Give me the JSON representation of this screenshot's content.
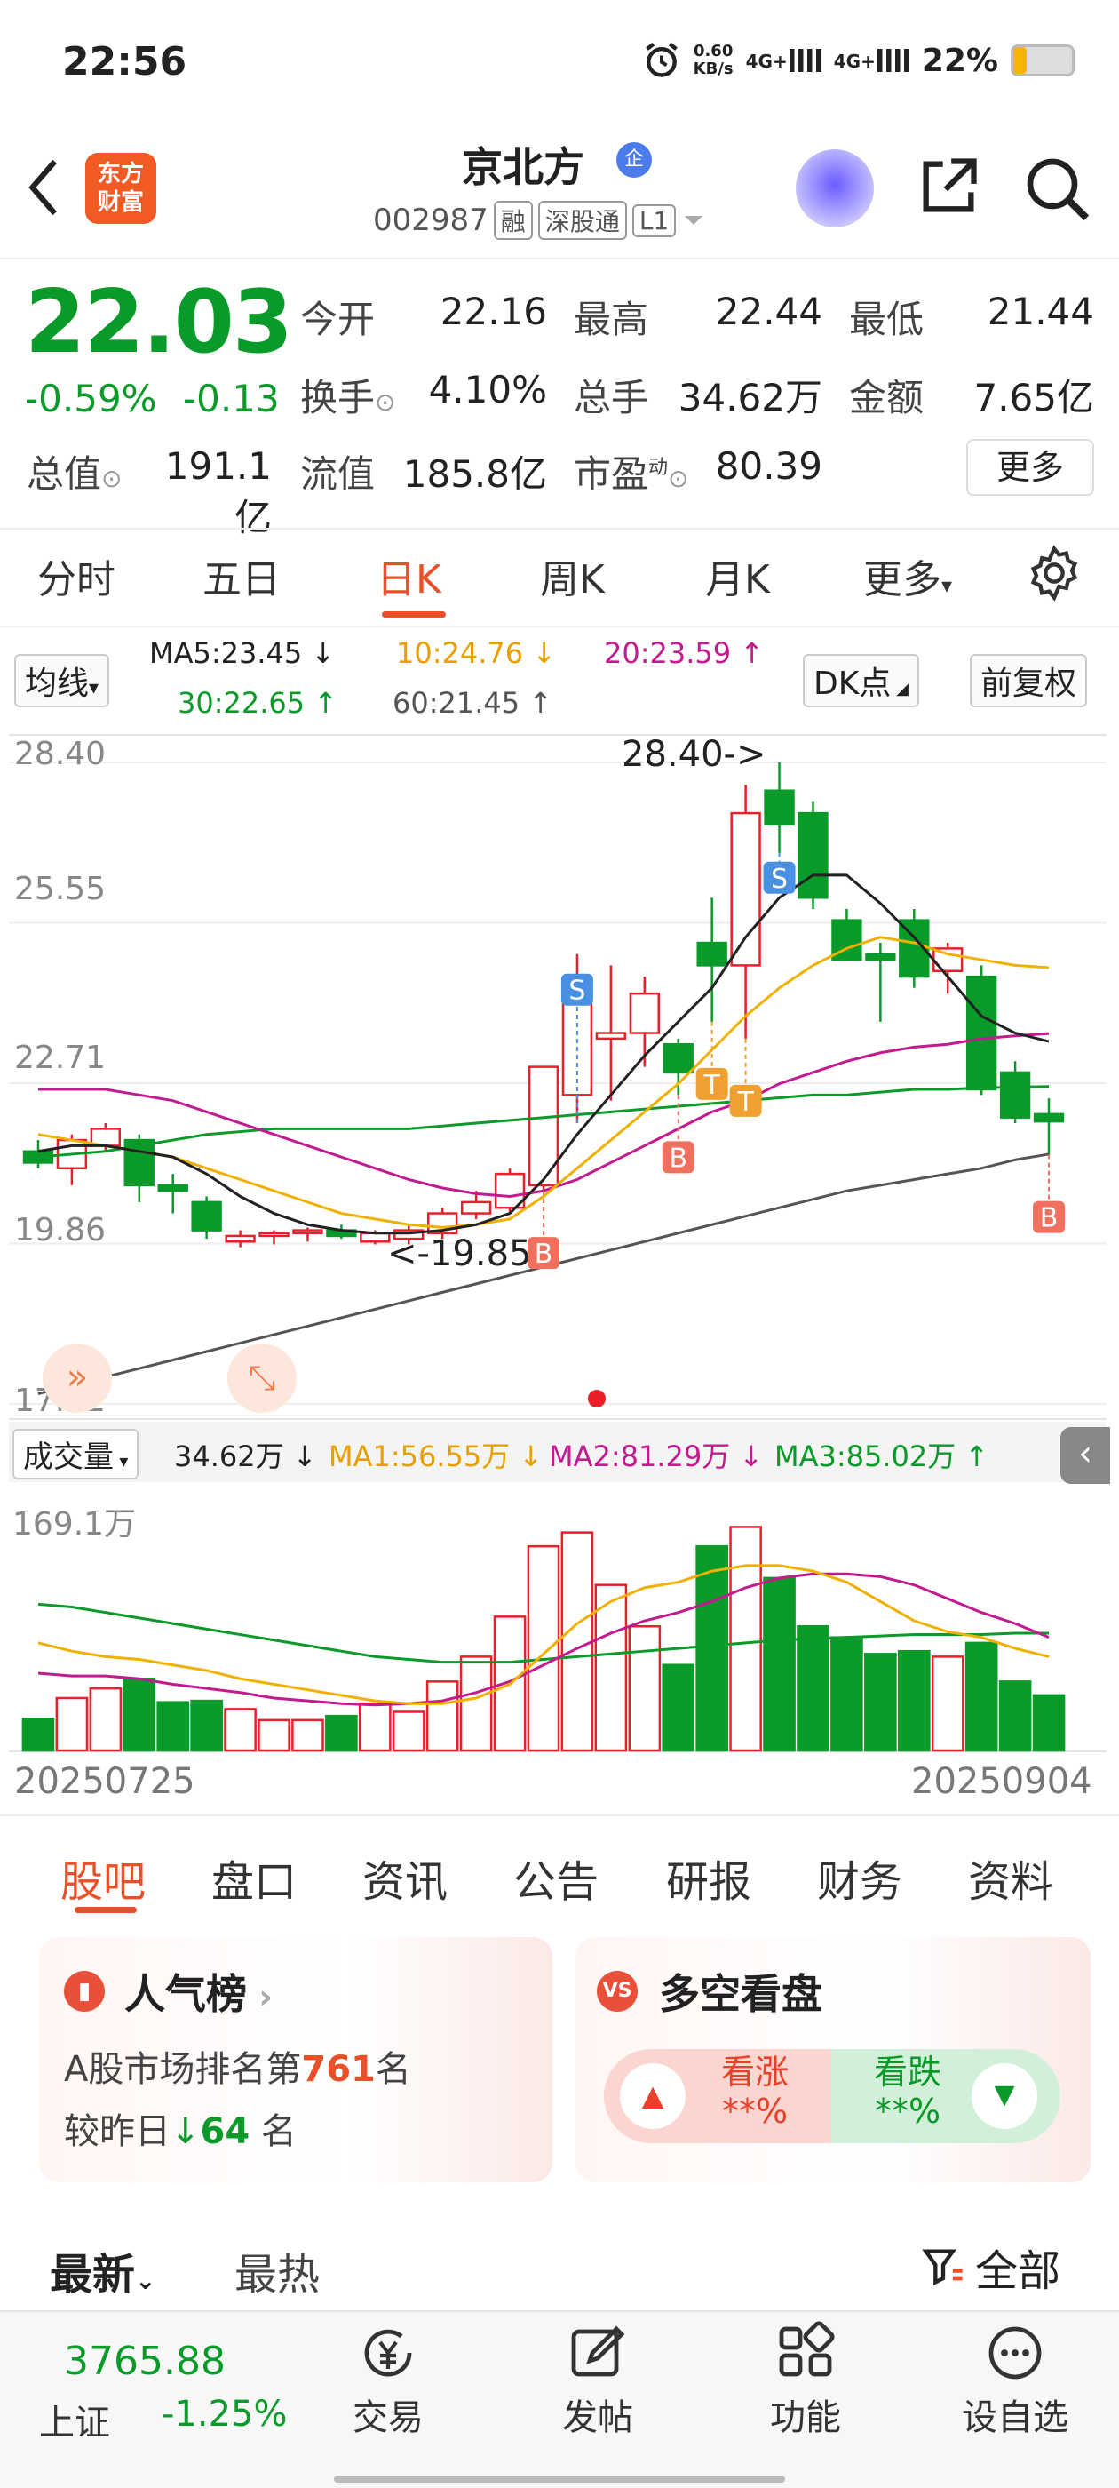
{
  "status_bar": {
    "time": "22:56",
    "net_speed": "0.60",
    "net_unit": "KB/s",
    "sig1": "4G+",
    "sig2": "4G+",
    "battery": "22%"
  },
  "header": {
    "logo_text": "东方\n财富",
    "name": "京北方",
    "badge": "企",
    "code": "002987",
    "tags": [
      "融",
      "深股通",
      "L1"
    ]
  },
  "quote": {
    "price": "22.03",
    "change_pct": "-0.59%",
    "change": "-0.13",
    "open_label": "今开",
    "open": "22.16",
    "high_label": "最高",
    "high": "22.44",
    "low_label": "最低",
    "low": "21.44",
    "turnover_label": "换手",
    "turnover": "4.10%",
    "volume_label": "总手",
    "volume": "34.62万",
    "amount_label": "金额",
    "amount": "7.65亿",
    "mcap_label": "总值",
    "mcap": "191.1亿",
    "float_label": "流值",
    "float": "185.8亿",
    "pe_label": "市盈",
    "pe_sup": "动",
    "pe": "80.39",
    "more_label": "更多"
  },
  "chart_tabs": [
    "分时",
    "五日",
    "日K",
    "周K",
    "月K",
    "更多"
  ],
  "active_chart_tab": "日K",
  "kline_legend": {
    "selector": "均线",
    "ma5": "MA5:23.45 ↓",
    "ma10": "10:24.76 ↓",
    "ma20": "20:23.59 ↑",
    "ma30": "30:22.65 ↑",
    "ma60": "60:21.45 ↑",
    "dk_label": "DK点",
    "adjust_label": "前复权"
  },
  "volume_legend": {
    "selector": "成交量",
    "vol": "34.62万 ↓",
    "ma1": "MA1:56.55万 ↓",
    "ma2": "MA2:81.29万 ↓",
    "ma3": "MA3:85.02万 ↑"
  },
  "colors": {
    "up": "#e8202a",
    "down": "#0a9a2a",
    "ma5": "#222222",
    "ma10": "#f0b000",
    "ma20": "#c41a8f",
    "ma30": "#0a9a2a",
    "ma60": "#555555",
    "accent": "#e8502a"
  },
  "chart_data": {
    "type": "candlestick",
    "y_ticks": [
      "28.40",
      "25.55",
      "22.71",
      "19.86",
      "17.02"
    ],
    "ylim": [
      17.02,
      28.4
    ],
    "x_labels": [
      "20250725",
      "20250904"
    ],
    "max_label": "28.40->",
    "min_label": "<-19.85",
    "vol_max_label": "169.1万",
    "candles": [
      {
        "o": 21.5,
        "h": 21.7,
        "l": 21.2,
        "c": 21.3
      },
      {
        "o": 21.2,
        "h": 21.8,
        "l": 20.9,
        "c": 21.7
      },
      {
        "o": 21.6,
        "h": 22.0,
        "l": 21.5,
        "c": 21.9
      },
      {
        "o": 21.7,
        "h": 21.8,
        "l": 20.6,
        "c": 20.9
      },
      {
        "o": 20.9,
        "h": 21.1,
        "l": 20.4,
        "c": 20.8
      },
      {
        "o": 20.6,
        "h": 20.7,
        "l": 19.95,
        "c": 20.1
      },
      {
        "o": 19.9,
        "h": 20.1,
        "l": 19.8,
        "c": 20.0
      },
      {
        "o": 20.0,
        "h": 20.1,
        "l": 19.85,
        "c": 20.05
      },
      {
        "o": 20.05,
        "h": 20.15,
        "l": 19.9,
        "c": 20.1
      },
      {
        "o": 20.1,
        "h": 20.2,
        "l": 19.95,
        "c": 20.0
      },
      {
        "o": 19.9,
        "h": 20.1,
        "l": 19.85,
        "c": 20.05
      },
      {
        "o": 19.95,
        "h": 20.2,
        "l": 19.85,
        "c": 20.1
      },
      {
        "o": 20.05,
        "h": 20.5,
        "l": 19.95,
        "c": 20.4
      },
      {
        "o": 20.4,
        "h": 20.8,
        "l": 20.3,
        "c": 20.6
      },
      {
        "o": 20.5,
        "h": 21.2,
        "l": 20.4,
        "c": 21.1
      },
      {
        "o": 20.9,
        "h": 23.0,
        "l": 20.8,
        "c": 23.0
      },
      {
        "o": 22.5,
        "h": 25.0,
        "l": 22.0,
        "c": 24.5
      },
      {
        "o": 23.5,
        "h": 24.8,
        "l": 22.4,
        "c": 23.6
      },
      {
        "o": 23.6,
        "h": 24.6,
        "l": 23.0,
        "c": 24.3
      },
      {
        "o": 23.4,
        "h": 23.5,
        "l": 22.5,
        "c": 22.9
      },
      {
        "o": 25.2,
        "h": 26.0,
        "l": 23.8,
        "c": 24.8
      },
      {
        "o": 24.8,
        "h": 28.0,
        "l": 23.5,
        "c": 27.5
      },
      {
        "o": 27.9,
        "h": 28.4,
        "l": 26.8,
        "c": 27.3
      },
      {
        "o": 27.5,
        "h": 27.7,
        "l": 25.8,
        "c": 26.0
      },
      {
        "o": 25.6,
        "h": 25.8,
        "l": 24.9,
        "c": 24.9
      },
      {
        "o": 25.0,
        "h": 25.2,
        "l": 23.8,
        "c": 24.9
      },
      {
        "o": 25.6,
        "h": 25.8,
        "l": 24.4,
        "c": 24.6
      },
      {
        "o": 24.7,
        "h": 25.2,
        "l": 24.3,
        "c": 25.1
      },
      {
        "o": 24.6,
        "h": 24.8,
        "l": 22.5,
        "c": 22.6
      },
      {
        "o": 22.9,
        "h": 23.1,
        "l": 22.0,
        "c": 22.1
      },
      {
        "o": 22.16,
        "h": 22.44,
        "l": 21.44,
        "c": 22.03
      }
    ],
    "volumes": [
      23,
      38,
      45,
      52,
      35,
      36,
      30,
      22,
      22,
      25,
      34,
      28,
      50,
      68,
      97,
      148,
      158,
      120,
      90,
      62,
      148,
      162,
      125,
      90,
      82,
      70,
      72,
      68,
      78,
      50,
      40
    ],
    "ma5": [
      21.5,
      21.6,
      21.6,
      21.5,
      21.4,
      21.1,
      20.7,
      20.4,
      20.2,
      20.1,
      20.05,
      20.05,
      20.1,
      20.2,
      20.4,
      21.0,
      21.8,
      22.5,
      23.2,
      23.8,
      24.4,
      25.3,
      26.0,
      26.4,
      26.4,
      25.9,
      25.3,
      24.6,
      23.9,
      23.6,
      23.45
    ],
    "ma10": [
      21.8,
      21.7,
      21.6,
      21.5,
      21.4,
      21.2,
      21.0,
      20.8,
      20.6,
      20.4,
      20.3,
      20.2,
      20.15,
      20.2,
      20.3,
      20.7,
      21.2,
      21.7,
      22.2,
      22.7,
      23.3,
      23.9,
      24.4,
      24.8,
      25.1,
      25.3,
      25.2,
      25.0,
      24.9,
      24.8,
      24.76
    ],
    "ma20": [
      22.6,
      22.6,
      22.6,
      22.5,
      22.4,
      22.2,
      22.0,
      21.8,
      21.6,
      21.4,
      21.2,
      21.0,
      20.85,
      20.75,
      20.7,
      20.8,
      21.0,
      21.3,
      21.6,
      21.9,
      22.2,
      22.4,
      22.7,
      22.9,
      23.1,
      23.25,
      23.35,
      23.4,
      23.5,
      23.55,
      23.59
    ],
    "ma30": [
      21.4,
      21.45,
      21.5,
      21.6,
      21.7,
      21.8,
      21.85,
      21.9,
      21.9,
      21.9,
      21.9,
      21.9,
      21.95,
      22.0,
      22.05,
      22.1,
      22.15,
      22.2,
      22.25,
      22.3,
      22.35,
      22.4,
      22.45,
      22.5,
      22.5,
      22.55,
      22.6,
      22.6,
      22.63,
      22.64,
      22.65
    ],
    "ma60": [
      17.2,
      17.35,
      17.5,
      17.65,
      17.8,
      17.95,
      18.1,
      18.25,
      18.4,
      18.55,
      18.7,
      18.85,
      19.0,
      19.15,
      19.3,
      19.45,
      19.6,
      19.75,
      19.9,
      20.05,
      20.2,
      20.35,
      20.5,
      20.65,
      20.8,
      20.9,
      21.0,
      21.1,
      21.2,
      21.35,
      21.45
    ],
    "vma1": [
      78,
      72,
      68,
      66,
      62,
      58,
      52,
      48,
      44,
      40,
      36,
      34,
      34,
      38,
      48,
      70,
      92,
      108,
      118,
      122,
      130,
      134,
      134,
      130,
      122,
      108,
      94,
      86,
      82,
      74,
      68
    ],
    "vma2": [
      56,
      54,
      54,
      52,
      48,
      45,
      42,
      38,
      36,
      34,
      33,
      34,
      36,
      42,
      50,
      62,
      74,
      85,
      94,
      100,
      108,
      118,
      125,
      128,
      128,
      126,
      120,
      110,
      100,
      92,
      82
    ],
    "vma3": [
      106,
      104,
      100,
      96,
      92,
      88,
      84,
      80,
      76,
      72,
      68,
      66,
      64,
      64,
      64,
      66,
      68,
      70,
      72,
      74,
      76,
      78,
      80,
      81,
      82,
      83,
      84,
      84,
      84,
      85,
      85
    ],
    "markers": [
      {
        "i": 15,
        "t": "B"
      },
      {
        "i": 16,
        "t": "S",
        "up": true
      },
      {
        "i": 19,
        "t": "B"
      },
      {
        "i": 20,
        "t": "T"
      },
      {
        "i": 21,
        "t": "T"
      },
      {
        "i": 22,
        "t": "S"
      },
      {
        "i": 30,
        "t": "B"
      }
    ]
  },
  "feed_tabs": [
    "股吧",
    "盘口",
    "资讯",
    "公告",
    "研报",
    "财务",
    "资料"
  ],
  "cards": {
    "popular_title": "人气榜",
    "rank_prefix": "A股市场排名第",
    "rank": "761",
    "rank_suffix": "名",
    "vs_prev_prefix": "较昨日",
    "vs_prev": "64",
    "vs_prev_suffix": "名",
    "bull_bear_title": "多空看盘",
    "bull_label": "看涨",
    "bull_value": "**%",
    "bear_label": "看跌",
    "bear_value": "**%"
  },
  "sort": {
    "latest": "最新",
    "hot": "最热",
    "filter": "全部"
  },
  "bottom": {
    "index_value": "3765.88",
    "index_name": "上证",
    "index_change": "-1.25%",
    "trade": "交易",
    "post": "发帖",
    "functions": "功能",
    "watchlist": "设自选"
  }
}
